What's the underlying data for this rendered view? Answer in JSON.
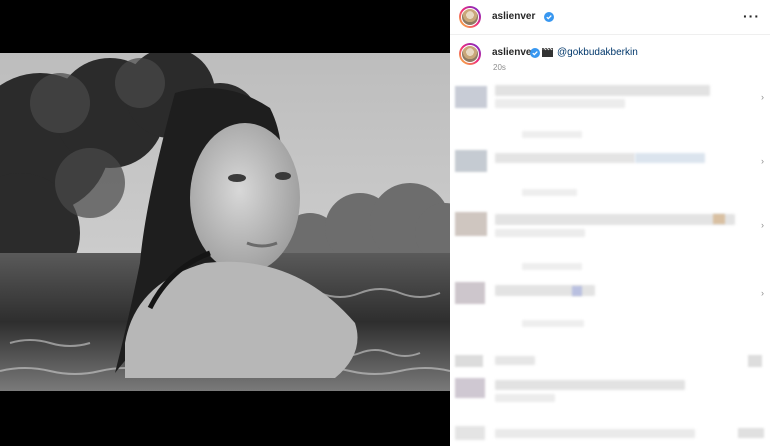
{
  "post": {
    "username": "aslienver",
    "mention": "@gokbudakberkin",
    "timestamp": "20s"
  },
  "icons": {
    "verified": "verified-badge-icon",
    "clapper": "clapper-board-icon",
    "more": "more-options-icon",
    "chevron": "chevron-right-icon"
  },
  "header": {
    "more_glyph": "···"
  },
  "comments": {
    "chevron_glyph": "›"
  },
  "colors": {
    "verified": "#3897f0",
    "mention": "#00376b",
    "muted": "#8e8e8e"
  }
}
